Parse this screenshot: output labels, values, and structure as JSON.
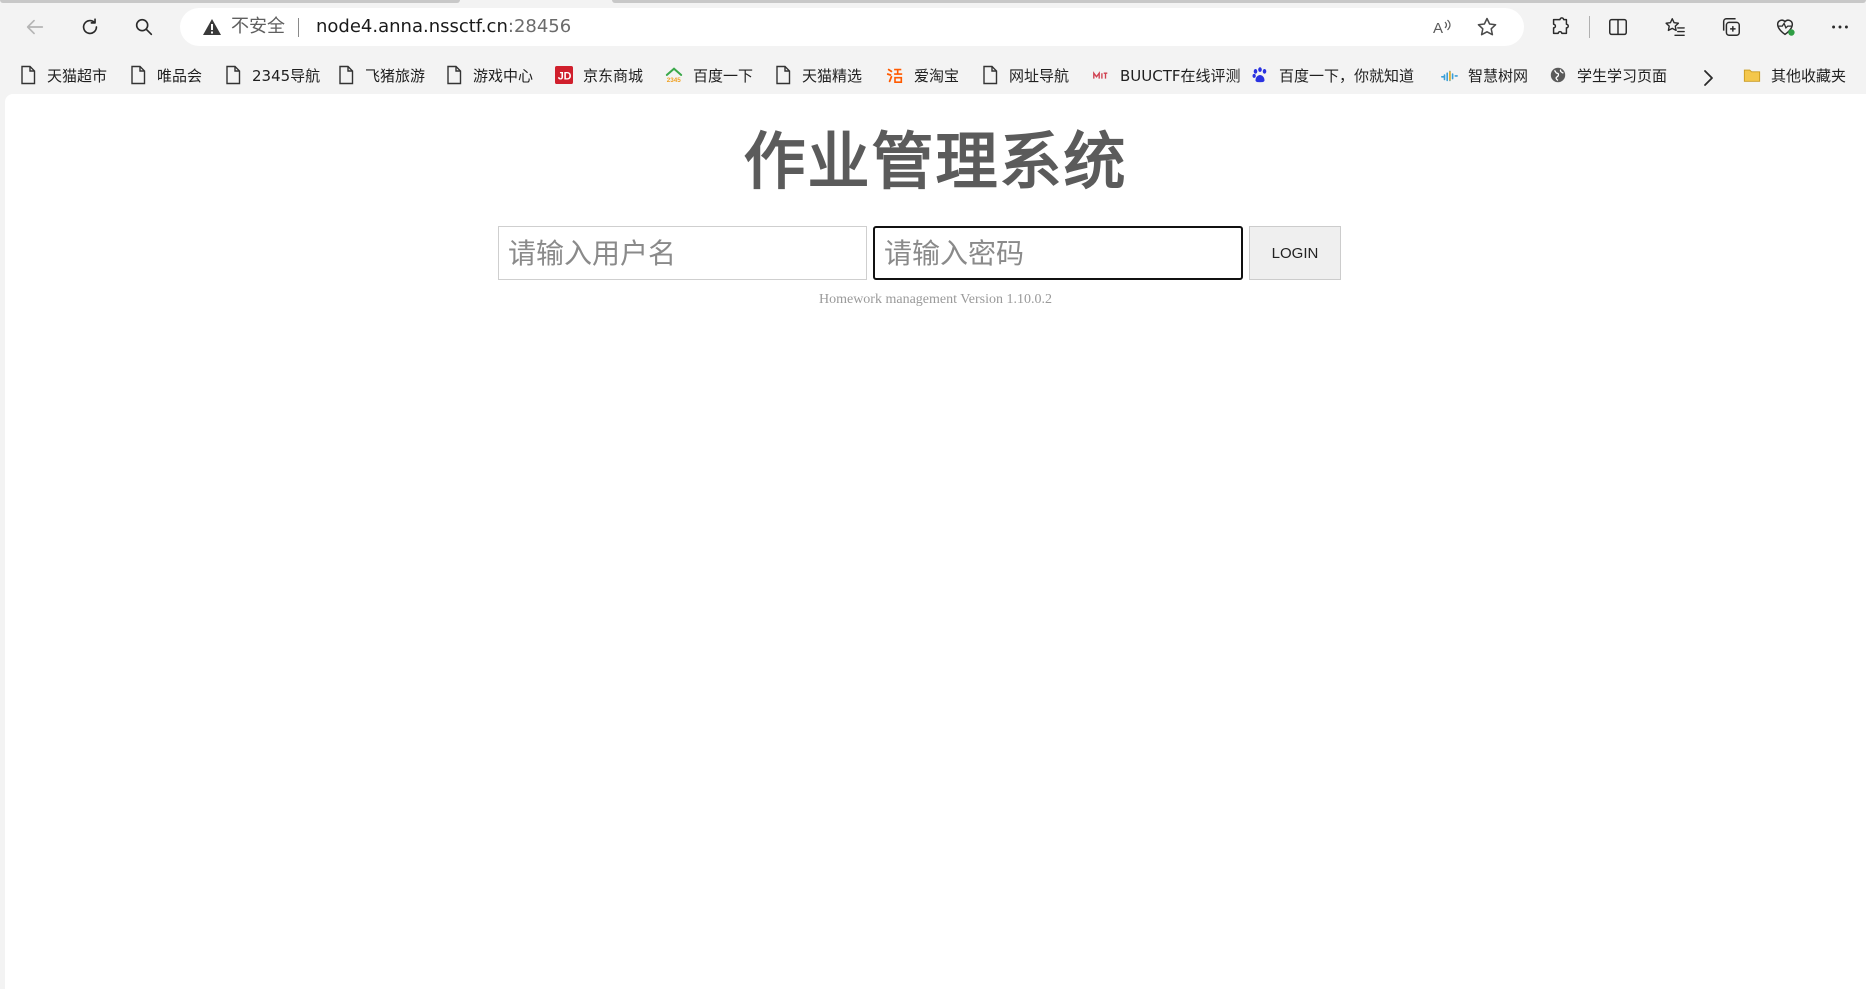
{
  "browser": {
    "security_label": "不安全",
    "url_host": "node4.anna.nssctf.cn",
    "url_port": ":28456"
  },
  "bookmarks": [
    {
      "label": "天猫超市",
      "icon": "page-icon"
    },
    {
      "label": "唯品会",
      "icon": "page-icon"
    },
    {
      "label": "2345导航",
      "icon": "page-icon"
    },
    {
      "label": "飞猪旅游",
      "icon": "page-icon"
    },
    {
      "label": "游戏中心",
      "icon": "page-icon"
    },
    {
      "label": "京东商城",
      "icon": "jd-logo-icon"
    },
    {
      "label": "百度一下",
      "icon": "2345-logo-icon"
    },
    {
      "label": "天猫精选",
      "icon": "page-icon"
    },
    {
      "label": "爱淘宝",
      "icon": "taobao-logo-icon"
    },
    {
      "label": "网址导航",
      "icon": "page-icon"
    },
    {
      "label": "BUUCTF在线评测",
      "icon": "buuctf-logo-icon"
    },
    {
      "label": "百度一下，你就知道",
      "icon": "baidu-paw-icon"
    },
    {
      "label": "智慧树网",
      "icon": "zhihuishu-logo-icon"
    },
    {
      "label": "学生学习页面",
      "icon": "globe-icon"
    }
  ],
  "bookmarks_folder": {
    "label": "其他收藏夹",
    "icon": "folder-icon"
  },
  "page": {
    "title": "作业管理系统",
    "username_placeholder": "请输入用户名",
    "password_placeholder": "请输入密码",
    "login_label": "LOGIN",
    "version": "Homework management Version 1.10.0.2"
  },
  "colors": {
    "title": "#5b5b5b",
    "chrome_bg": "#f3f3f3",
    "page_bg": "#ffffff"
  }
}
